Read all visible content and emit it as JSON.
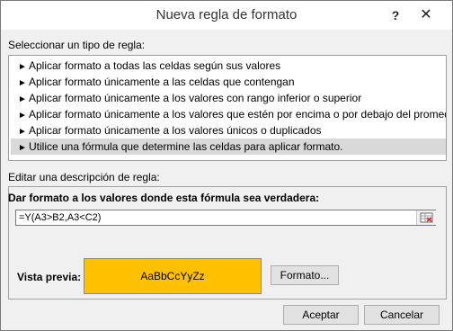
{
  "window": {
    "title": "Nueva regla de formato",
    "help_label": "?",
    "close_label": "✕"
  },
  "rule_types": {
    "label": "Seleccionar un tipo de regla:",
    "selected_index": 5,
    "items": [
      {
        "label": "Aplicar formato a todas las celdas según sus valores"
      },
      {
        "label": "Aplicar formato únicamente a las celdas que contengan"
      },
      {
        "label": "Aplicar formato únicamente a los valores con rango inferior o superior"
      },
      {
        "label": "Aplicar formato únicamente a los valores que estén por encima o por debajo del promedio"
      },
      {
        "label": "Aplicar formato únicamente a los valores únicos o duplicados"
      },
      {
        "label": "Utilice una fórmula que determine las celdas para aplicar formato."
      }
    ]
  },
  "edit": {
    "label": "Editar una descripción de regla:",
    "formula_label": "Dar formato a los valores donde esta fórmula sea verdadera:",
    "formula_value": "=Y(A3>B2,A3<C2)",
    "preview_label": "Vista previa:",
    "preview_text": "AaBbCcYyZz",
    "preview_color": "#ffc000",
    "format_button": "Formato..."
  },
  "buttons": {
    "accept": "Aceptar",
    "cancel": "Cancelar"
  },
  "icons": {
    "rule_arrow": "arrow-right-icon",
    "collapse": "range-selector-icon"
  }
}
